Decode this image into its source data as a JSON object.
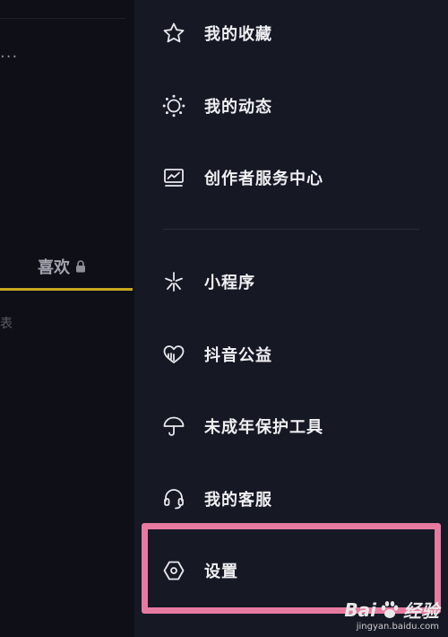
{
  "left_pane": {
    "more": "...",
    "tab_label": "喜欢",
    "hint_fragment": "表"
  },
  "menu": {
    "items": [
      {
        "label": "我的收藏",
        "icon": "star-icon"
      },
      {
        "label": "我的动态",
        "icon": "sun-ring-icon"
      },
      {
        "label": "创作者服务中心",
        "icon": "chart-monitor-icon"
      },
      {
        "label": "小程序",
        "icon": "asterisk-icon"
      },
      {
        "label": "抖音公益",
        "icon": "heart-hand-icon"
      },
      {
        "label": "未成年保护工具",
        "icon": "umbrella-icon"
      },
      {
        "label": "我的客服",
        "icon": "headset-icon"
      },
      {
        "label": "设置",
        "icon": "hex-gear-icon"
      }
    ]
  },
  "watermark": {
    "brand_prefix": "Bai",
    "brand_suffix": "经验",
    "url": "jingyan.baidu.com"
  },
  "colors": {
    "background": "#161824",
    "left_pane": "#0f1017",
    "underline": "#c8a820",
    "highlight": "#e77aa0",
    "text": "#f0f0f3"
  }
}
